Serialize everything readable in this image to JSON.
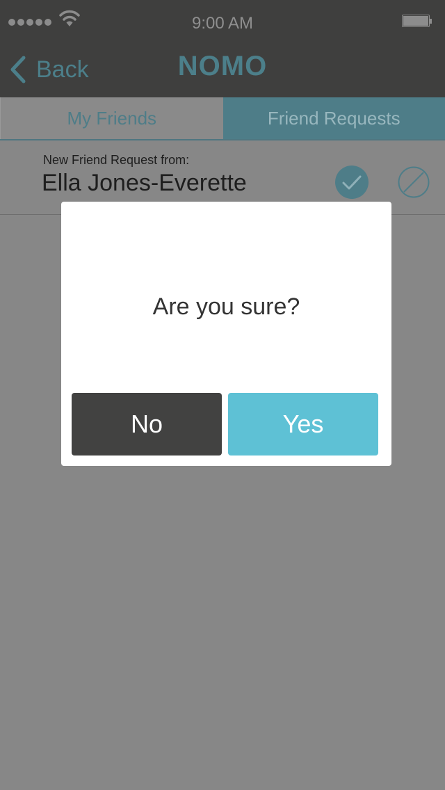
{
  "status_bar": {
    "time": "9:00 AM",
    "signal_icon": "signal-dots-icon",
    "wifi_icon": "wifi-icon",
    "battery_icon": "battery-icon"
  },
  "nav": {
    "back_label": "Back",
    "back_icon": "chevron-left-icon",
    "title": "NOMO"
  },
  "tabs": [
    {
      "label": "My Friends",
      "active": false
    },
    {
      "label": "Friend Requests",
      "active": true
    }
  ],
  "request": {
    "caption": "New Friend Request from:",
    "name": "Ella Jones-Everette",
    "accept_icon": "checkmark-icon",
    "decline_icon": "block-icon"
  },
  "dialog": {
    "message": "Are you sure?",
    "no_label": "No",
    "yes_label": "Yes"
  },
  "colors": {
    "accent": "#4e7d88",
    "yes_button": "#5ec1d5",
    "no_button": "#424241",
    "nav_background": "#3f3f3e",
    "overlay_background": "#878787"
  }
}
